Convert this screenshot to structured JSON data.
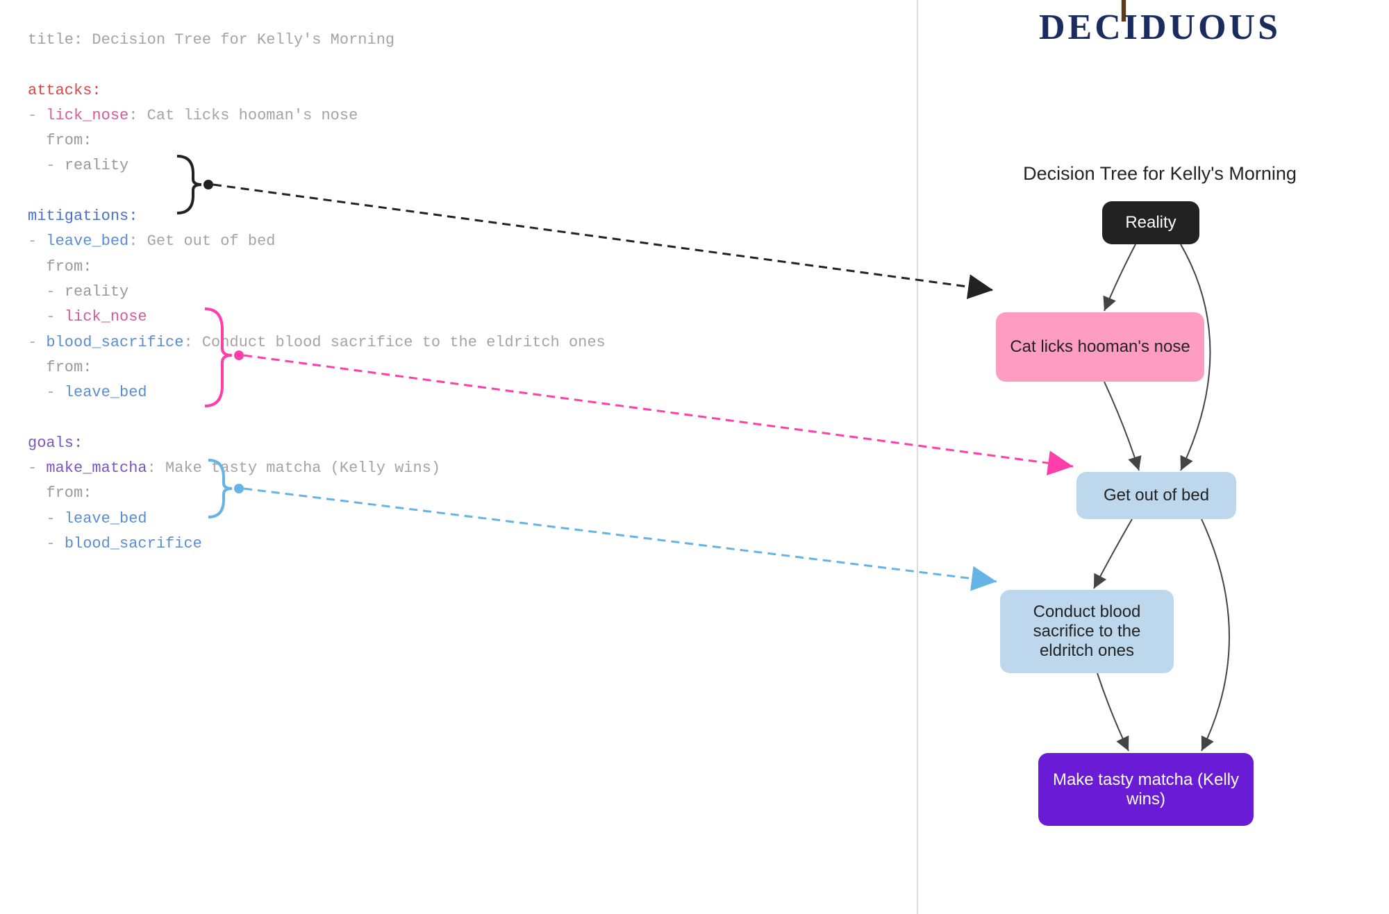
{
  "logo_text": "DECIDUOUS",
  "graph_title": "Decision Tree for Kelly's Morning",
  "code": {
    "title_key": "title:",
    "title_val": " Decision Tree for Kelly's Morning",
    "attacks_key": "attacks:",
    "lick_nose_key": "lick_nose",
    "lick_nose_desc": ": Cat licks hooman's nose",
    "from_key": "from:",
    "reality_val": "reality",
    "mitigations_key": "mitigations:",
    "leave_bed_key": "leave_bed",
    "leave_bed_desc": ": Get out of bed",
    "lick_nose_ref": "lick_nose",
    "blood_key": "blood_sacrifice",
    "blood_desc": ": Conduct blood sacrifice to the eldritch ones",
    "leave_bed_ref": "leave_bed",
    "goals_key": "goals:",
    "matcha_key": "make_matcha",
    "matcha_desc": ": Make tasty matcha (Kelly wins)",
    "blood_ref": "blood_sacrifice"
  },
  "nodes": {
    "reality": "Reality",
    "attack1": "Cat licks hooman's nose",
    "mit1": "Get out of bed",
    "mit2": "Conduct blood sacrifice to the eldritch ones",
    "goal": "Make tasty matcha (Kelly wins)"
  },
  "chart_data": {
    "type": "diagram",
    "title": "Decision Tree for Kelly's Morning",
    "nodes": [
      {
        "id": "reality",
        "label": "Reality",
        "type": "root",
        "color": "#222222"
      },
      {
        "id": "lick_nose",
        "label": "Cat licks hooman's nose",
        "type": "attack",
        "color": "#ff9cc1"
      },
      {
        "id": "leave_bed",
        "label": "Get out of bed",
        "type": "mitigation",
        "color": "#bdd8ec"
      },
      {
        "id": "blood_sacrifice",
        "label": "Conduct blood sacrifice to the eldritch ones",
        "type": "mitigation",
        "color": "#bdd8ec"
      },
      {
        "id": "make_matcha",
        "label": "Make tasty matcha (Kelly wins)",
        "type": "goal",
        "color": "#6a1bd6"
      }
    ],
    "edges": [
      {
        "from": "reality",
        "to": "lick_nose"
      },
      {
        "from": "reality",
        "to": "leave_bed"
      },
      {
        "from": "lick_nose",
        "to": "leave_bed"
      },
      {
        "from": "leave_bed",
        "to": "blood_sacrifice"
      },
      {
        "from": "leave_bed",
        "to": "make_matcha"
      },
      {
        "from": "blood_sacrifice",
        "to": "make_matcha"
      }
    ],
    "callouts": [
      {
        "from_code_block": "attacks.lick_nose.from",
        "to_node": "lick_nose",
        "color": "#222222"
      },
      {
        "from_code_block": "mitigations.leave_bed.from",
        "to_node": "leave_bed",
        "color": "#ff3eaa"
      },
      {
        "from_code_block": "mitigations.blood_sacrifice.from",
        "to_node": "blood_sacrifice",
        "color": "#66b3e6"
      }
    ]
  }
}
